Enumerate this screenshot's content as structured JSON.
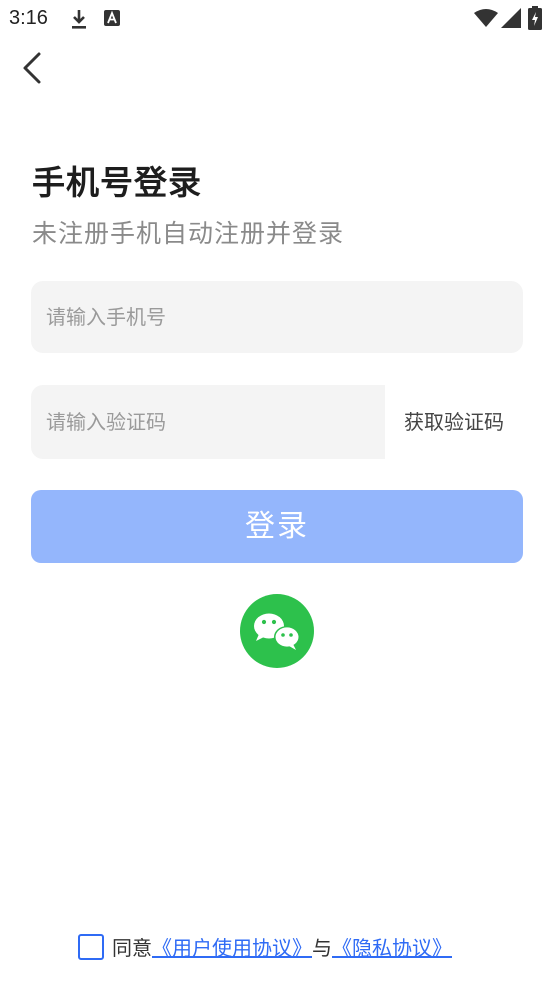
{
  "status_bar": {
    "time": "3:16",
    "icons": [
      "download-icon",
      "a-icon",
      "wifi-icon",
      "signal-icon",
      "battery-icon"
    ]
  },
  "nav": {
    "back_icon": "chevron-left-icon"
  },
  "header": {
    "title": "手机号登录",
    "subtitle": "未注册手机自动注册并登录"
  },
  "form": {
    "phone": {
      "value": "",
      "placeholder": "请输入手机号"
    },
    "code": {
      "value": "",
      "placeholder": "请输入验证码"
    },
    "get_code_label": "获取验证码",
    "login_label": "登录"
  },
  "social": {
    "wechat_icon": "wechat-icon"
  },
  "agreement": {
    "checked": false,
    "prefix": "同意",
    "user_agreement": "《用户使用协议》",
    "and": "与",
    "privacy_policy": "《隐私协议》"
  },
  "colors": {
    "accent": "#2f6bf5",
    "login_button": "#94b6fc",
    "wechat": "#2dc14c",
    "field_bg": "#f4f4f4"
  }
}
